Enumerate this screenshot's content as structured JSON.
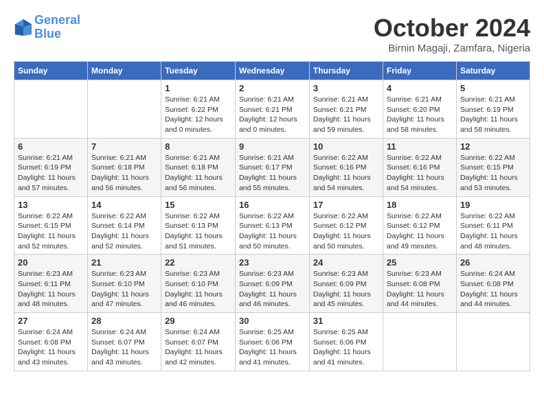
{
  "logo": {
    "line1": "General",
    "line2": "Blue"
  },
  "title": "October 2024",
  "subtitle": "Birnin Magaji, Zamfara, Nigeria",
  "days_of_week": [
    "Sunday",
    "Monday",
    "Tuesday",
    "Wednesday",
    "Thursday",
    "Friday",
    "Saturday"
  ],
  "weeks": [
    [
      {
        "day": "",
        "content": ""
      },
      {
        "day": "",
        "content": ""
      },
      {
        "day": "1",
        "content": "Sunrise: 6:21 AM\nSunset: 6:22 PM\nDaylight: 12 hours\nand 0 minutes."
      },
      {
        "day": "2",
        "content": "Sunrise: 6:21 AM\nSunset: 6:21 PM\nDaylight: 12 hours\nand 0 minutes."
      },
      {
        "day": "3",
        "content": "Sunrise: 6:21 AM\nSunset: 6:21 PM\nDaylight: 11 hours\nand 59 minutes."
      },
      {
        "day": "4",
        "content": "Sunrise: 6:21 AM\nSunset: 6:20 PM\nDaylight: 11 hours\nand 58 minutes."
      },
      {
        "day": "5",
        "content": "Sunrise: 6:21 AM\nSunset: 6:19 PM\nDaylight: 11 hours\nand 58 minutes."
      }
    ],
    [
      {
        "day": "6",
        "content": "Sunrise: 6:21 AM\nSunset: 6:19 PM\nDaylight: 11 hours\nand 57 minutes."
      },
      {
        "day": "7",
        "content": "Sunrise: 6:21 AM\nSunset: 6:18 PM\nDaylight: 11 hours\nand 56 minutes."
      },
      {
        "day": "8",
        "content": "Sunrise: 6:21 AM\nSunset: 6:18 PM\nDaylight: 11 hours\nand 56 minutes."
      },
      {
        "day": "9",
        "content": "Sunrise: 6:21 AM\nSunset: 6:17 PM\nDaylight: 11 hours\nand 55 minutes."
      },
      {
        "day": "10",
        "content": "Sunrise: 6:22 AM\nSunset: 6:16 PM\nDaylight: 11 hours\nand 54 minutes."
      },
      {
        "day": "11",
        "content": "Sunrise: 6:22 AM\nSunset: 6:16 PM\nDaylight: 11 hours\nand 54 minutes."
      },
      {
        "day": "12",
        "content": "Sunrise: 6:22 AM\nSunset: 6:15 PM\nDaylight: 11 hours\nand 53 minutes."
      }
    ],
    [
      {
        "day": "13",
        "content": "Sunrise: 6:22 AM\nSunset: 6:15 PM\nDaylight: 11 hours\nand 52 minutes."
      },
      {
        "day": "14",
        "content": "Sunrise: 6:22 AM\nSunset: 6:14 PM\nDaylight: 11 hours\nand 52 minutes."
      },
      {
        "day": "15",
        "content": "Sunrise: 6:22 AM\nSunset: 6:13 PM\nDaylight: 11 hours\nand 51 minutes."
      },
      {
        "day": "16",
        "content": "Sunrise: 6:22 AM\nSunset: 6:13 PM\nDaylight: 11 hours\nand 50 minutes."
      },
      {
        "day": "17",
        "content": "Sunrise: 6:22 AM\nSunset: 6:12 PM\nDaylight: 11 hours\nand 50 minutes."
      },
      {
        "day": "18",
        "content": "Sunrise: 6:22 AM\nSunset: 6:12 PM\nDaylight: 11 hours\nand 49 minutes."
      },
      {
        "day": "19",
        "content": "Sunrise: 6:22 AM\nSunset: 6:11 PM\nDaylight: 11 hours\nand 48 minutes."
      }
    ],
    [
      {
        "day": "20",
        "content": "Sunrise: 6:23 AM\nSunset: 6:11 PM\nDaylight: 11 hours\nand 48 minutes."
      },
      {
        "day": "21",
        "content": "Sunrise: 6:23 AM\nSunset: 6:10 PM\nDaylight: 11 hours\nand 47 minutes."
      },
      {
        "day": "22",
        "content": "Sunrise: 6:23 AM\nSunset: 6:10 PM\nDaylight: 11 hours\nand 46 minutes."
      },
      {
        "day": "23",
        "content": "Sunrise: 6:23 AM\nSunset: 6:09 PM\nDaylight: 11 hours\nand 46 minutes."
      },
      {
        "day": "24",
        "content": "Sunrise: 6:23 AM\nSunset: 6:09 PM\nDaylight: 11 hours\nand 45 minutes."
      },
      {
        "day": "25",
        "content": "Sunrise: 6:23 AM\nSunset: 6:08 PM\nDaylight: 11 hours\nand 44 minutes."
      },
      {
        "day": "26",
        "content": "Sunrise: 6:24 AM\nSunset: 6:08 PM\nDaylight: 11 hours\nand 44 minutes."
      }
    ],
    [
      {
        "day": "27",
        "content": "Sunrise: 6:24 AM\nSunset: 6:08 PM\nDaylight: 11 hours\nand 43 minutes."
      },
      {
        "day": "28",
        "content": "Sunrise: 6:24 AM\nSunset: 6:07 PM\nDaylight: 11 hours\nand 43 minutes."
      },
      {
        "day": "29",
        "content": "Sunrise: 6:24 AM\nSunset: 6:07 PM\nDaylight: 11 hours\nand 42 minutes."
      },
      {
        "day": "30",
        "content": "Sunrise: 6:25 AM\nSunset: 6:06 PM\nDaylight: 11 hours\nand 41 minutes."
      },
      {
        "day": "31",
        "content": "Sunrise: 6:25 AM\nSunset: 6:06 PM\nDaylight: 11 hours\nand 41 minutes."
      },
      {
        "day": "",
        "content": ""
      },
      {
        "day": "",
        "content": ""
      }
    ]
  ]
}
